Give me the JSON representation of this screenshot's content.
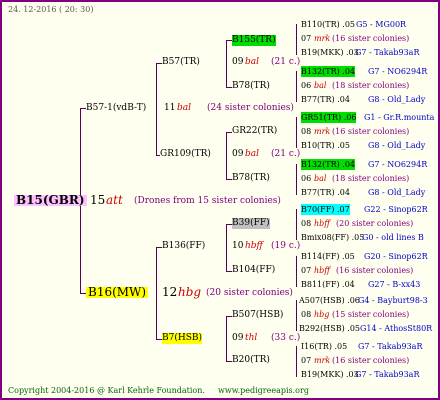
{
  "header": {
    "date": "24. 12-2016 ( 20: 30)"
  },
  "footer": {
    "copyright": "Copyright 2004-2016 @ Karl Kehrle Foundation.",
    "site": "www.pedigreeapis.org"
  },
  "root": {
    "id": "B15(GBR)",
    "num": "15",
    "breeder": "att",
    "note": "(Drones from 15 sister colonies)"
  },
  "upper": {
    "sire": "B57-1(vdB-T)",
    "num": "11",
    "breeder": "bal",
    "note": "(24 sister colonies)",
    "a": {
      "id": "B57(TR)",
      "num": "09",
      "breeder": "bal",
      "note": "(21 c.)",
      "top": {
        "id": "B155(TR)",
        "c1": "B110(TR) .05",
        "c1r": "G5 - MG00R",
        "m": "07",
        "mb": "mrk",
        "mn": "(16 sister colonies)",
        "c2": "B19(MKK) .03",
        "c2r": "G7 - Takab93aR"
      },
      "bot": {
        "id": "B78(TR)",
        "c1": "B132(TR) .04",
        "c1r": "G7 - NO6294R",
        "m": "06",
        "mb": "bal",
        "mn": "(18 sister colonies)",
        "c2": "B77(TR) .04",
        "c2r": "G8 - Old_Lady"
      }
    },
    "b": {
      "id": "GR109(TR)",
      "num": "09",
      "breeder": "bal",
      "note": "(21 c.)",
      "top": {
        "id": "GR22(TR)",
        "c1": "GR51(TR) .06",
        "c1r": "G1 - Gr.R.mounta",
        "m": "08",
        "mb": "mrk",
        "mn": "(16 sister colonies)",
        "c2": "B10(TR) .05",
        "c2r": "G8 - Old_Lady"
      },
      "bot": {
        "id": "B78(TR)",
        "c1": "B132(TR) .04",
        "c1r": "G7 - NO6294R",
        "m": "06",
        "mb": "bal",
        "mn": "(18 sister colonies)",
        "c2": "B77(TR) .04",
        "c2r": "G8 - Old_Lady"
      }
    }
  },
  "lower": {
    "dam": "B16(MW)",
    "num": "12",
    "breeder": "hbg",
    "note": "(20 sister colonies)",
    "a": {
      "id": "B136(FF)",
      "num": "10",
      "breeder": "hbff",
      "note": "(19 c.)",
      "top": {
        "id": "B39(FF)",
        "c1": "B70(FF) .07",
        "c1r": "G22 - Sinop62R",
        "m": "08",
        "mb": "hbff",
        "mn": "(20 sister colonies)",
        "c2": "Bmix08(FF) .05",
        "c2r": "G0 - old lines B"
      },
      "bot": {
        "id": "B104(FF)",
        "c1": "B114(FF) .05",
        "c1r": "G20 - Sinop62R",
        "m": "07",
        "mb": "hbff",
        "mn": "(16 sister colonies)",
        "c2": "B811(FF) .04",
        "c2r": "G27 - B-xx43"
      }
    },
    "b": {
      "id": "B7(HSB)",
      "num": "09",
      "breeder": "thl",
      "note": "(33 c.)",
      "top": {
        "id": "B507(HSB)",
        "c1": "A507(HSB) .06",
        "c1r": "G4 - Bayburt98-3",
        "m": "08",
        "mb": "hbg",
        "mn": "(15 sister colonies)",
        "c2": "B292(HSB) .05",
        "c2r": "G14 - AthosSt80R"
      },
      "bot": {
        "id": "B20(TR)",
        "c1": "I16(TR) .05",
        "c1r": "G7 - Takab93aR",
        "m": "07",
        "mb": "mrk",
        "mn": "(16 sister colonies)",
        "c2": "B19(MKK) .03",
        "c2r": "G7 - Takab93aR"
      }
    }
  }
}
